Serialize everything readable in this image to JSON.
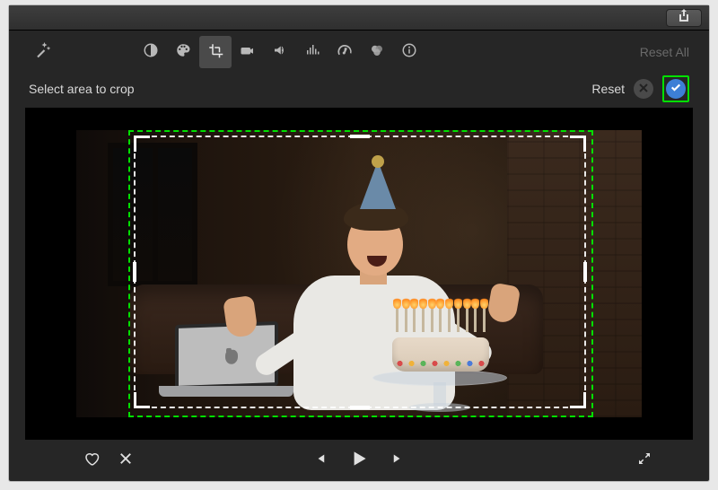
{
  "titlebar": {
    "share": "Share"
  },
  "toolbar": {
    "auto_enhance": "Auto Enhance",
    "items": [
      {
        "name": "color-balance",
        "active": false
      },
      {
        "name": "color-correction",
        "active": false
      },
      {
        "name": "crop",
        "active": true
      },
      {
        "name": "stabilization",
        "active": false
      },
      {
        "name": "volume",
        "active": false
      },
      {
        "name": "noise-reduction",
        "active": false
      },
      {
        "name": "speed",
        "active": false
      },
      {
        "name": "color-filter",
        "active": false
      },
      {
        "name": "info",
        "active": false
      }
    ],
    "reset_all_label": "Reset All"
  },
  "crop_bar": {
    "instruction": "Select area to crop",
    "reset_label": "Reset",
    "cancel_label": "Cancel",
    "apply_label": "Apply"
  },
  "playback": {
    "favorite": "Favorite",
    "reject": "Reject",
    "prev_frame": "Previous Frame",
    "play": "Play",
    "next_frame": "Next Frame",
    "fullscreen": "Fullscreen"
  },
  "colors": {
    "highlight_green": "#00e000",
    "apply_blue": "#3d7fd6"
  }
}
